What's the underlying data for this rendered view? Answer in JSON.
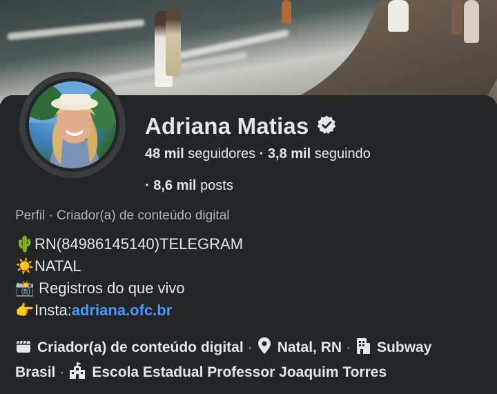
{
  "profile": {
    "name": "Adriana Matias",
    "followers_value": "48 mil",
    "followers_label": "seguidores",
    "following_value": "3,8 mil",
    "following_label": "seguindo",
    "posts_value": "8,6 mil",
    "posts_label": "posts",
    "dot": "·",
    "category_line": "Perfil · Criador(a) de conteúdo digital"
  },
  "bio": {
    "line1_emoji": "🌵",
    "line1_text": "RN(84986145140)TELEGRAM",
    "line2_emoji": "☀️",
    "line2_text": "NATAL",
    "line3_emoji": "📸",
    "line3_text": " Registros do que vivo",
    "line4_emoji": "👉",
    "line4_prefix": "Insta:",
    "line4_link": "adriana.ofc.br"
  },
  "details": {
    "item1": "Criador(a) de conteúdo digital",
    "item2": "Natal, RN",
    "item3": "Subway Brasil",
    "item4": "Escola Estadual Professor Joaquim Torres",
    "sep": "·"
  },
  "icons": {
    "verified": "verified-badge-icon",
    "category": "clapperboard-icon",
    "location": "map-pin-icon",
    "work": "building-icon",
    "school": "school-icon"
  },
  "colors": {
    "background": "#242526",
    "link": "#4599ff",
    "muted": "#b0b3b8",
    "text": "#e4e6eb"
  }
}
